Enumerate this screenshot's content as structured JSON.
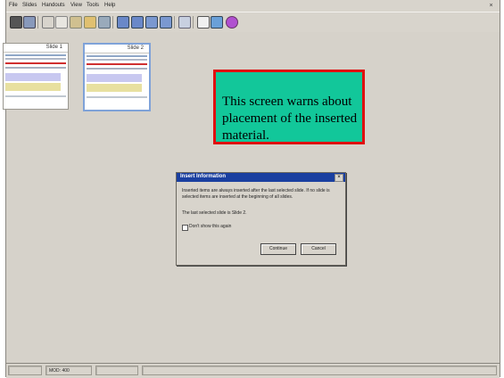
{
  "menu": {
    "items": [
      "File",
      "Slides",
      "Handouts",
      "View",
      "Tools",
      "Help"
    ]
  },
  "toolbar": {
    "icons": [
      "new-icon",
      "save-icon",
      "cut-icon",
      "copy-icon",
      "paste-icon",
      "insert-icon",
      "slide-icon",
      "handout-icon",
      "duplicate-icon",
      "delete-icon",
      "help-icon"
    ]
  },
  "slides": [
    {
      "title": "Slide 1"
    },
    {
      "title": "Slide 2"
    }
  ],
  "callout": {
    "text": "This screen warns about placement of the inserted material."
  },
  "dialog": {
    "title": "Insert Information",
    "message": "Inserted items are always inserted after the last selected slide. If no slide is selected items are inserted at the beginning of all slides.",
    "detail": "The last selected slide is Slide 2.",
    "checkbox_label": "Don't show this again",
    "continue_label": "Continue",
    "cancel_label": "Cancel"
  },
  "status": {
    "zoom": "MOD: 400"
  },
  "colors": {
    "window": "#d8d4cc",
    "callout_fill": "#12c79a",
    "callout_border": "#e01010",
    "dialog_title": "#1a3fa0",
    "selected_slide": "#7fa2d8"
  }
}
